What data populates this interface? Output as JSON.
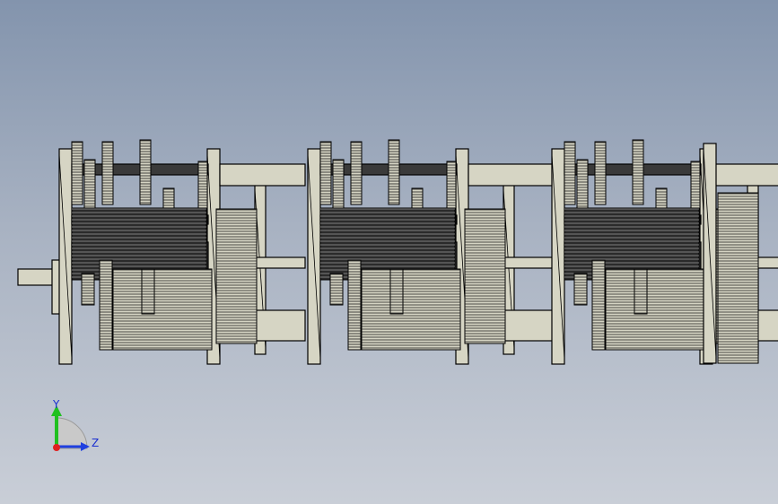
{
  "viewport": {
    "background_top": "#8394ad",
    "background_bottom": "#c9ced7",
    "model_outline_color": "#000000",
    "model_fill_color": "#d6d5c4"
  },
  "model": {
    "description_icon": "gearbox-assembly-wireframe",
    "section_count": 3
  },
  "triad": {
    "x_axis_color": "#e02020",
    "y_axis_color": "#20c020",
    "z_axis_color": "#2040e0",
    "y_label": "Y",
    "z_label": "Z"
  }
}
